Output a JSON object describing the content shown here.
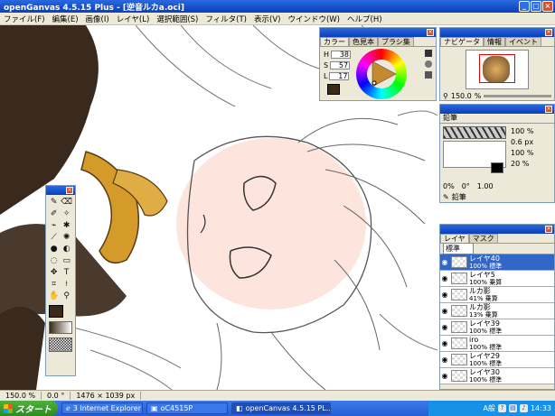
{
  "window": {
    "title": "openGanvas 4.5.15 Plus - [逆音ルカa.oci]",
    "minimize": "_",
    "maximize": "□",
    "close": "×"
  },
  "menu": [
    "ファイル(F)",
    "編集(E)",
    "画像(I)",
    "レイヤ(L)",
    "選択範囲(S)",
    "フィルタ(T)",
    "表示(V)",
    "ウインドウ(W)",
    "ヘルプ(H)"
  ],
  "color_panel": {
    "tabs": [
      "カラー",
      "色見本",
      "ブラシ集"
    ],
    "h_label": "H",
    "h_value": "38",
    "s_label": "S",
    "s_value": "57",
    "l_label": "L",
    "l_value": "17",
    "current_color": "#3a2a16"
  },
  "navigator_panel": {
    "tabs": [
      "ナビゲータ",
      "情報",
      "イベント"
    ],
    "zoom": "150.0",
    "zoom_unit": "%"
  },
  "brush_panel": {
    "title": "鉛筆",
    "opacity": "100",
    "opacity_unit": "%",
    "size": "0.6",
    "size_unit": "px",
    "density": "100",
    "density_unit": "%",
    "min_size": "20",
    "min_size_unit": "%",
    "pressure_1": "0%",
    "pressure_2": "0°",
    "scale": "1.00",
    "tool_name": "鉛筆"
  },
  "layer_panel": {
    "tabs": [
      "レイヤ",
      "マスク"
    ],
    "blend": "標準",
    "layers": [
      {
        "name": "レイヤ40",
        "info": "100% 標準",
        "selected": true
      },
      {
        "name": "レイヤ5",
        "info": "100% 乗算",
        "selected": false
      },
      {
        "name": "ルカ影",
        "info": "41% 乗算",
        "selected": false
      },
      {
        "name": "ルカ影",
        "info": "13% 乗算",
        "selected": false
      },
      {
        "name": "レイヤ39",
        "info": "100% 標準",
        "selected": false
      },
      {
        "name": "iro",
        "info": "100% 標準",
        "selected": false
      },
      {
        "name": "レイヤ29",
        "info": "100% 標準",
        "selected": false
      },
      {
        "name": "レイヤ30",
        "info": "100% 標準",
        "selected": false
      }
    ]
  },
  "status": {
    "zoom": "150.0 %",
    "angle": "0.0 °",
    "size": "1476 × 1039 px"
  },
  "taskbar": {
    "start": "スタート",
    "tasks": [
      "3 Internet Explorer",
      "oC4515P",
      "openCanvas 4.5.15 PL..."
    ],
    "clock": "14:33",
    "ime": "A般"
  },
  "colors": {
    "accent": "#0a3fb8",
    "skin": "#fde5dd",
    "gold": "#d49a2a",
    "dark": "#3a2a1e"
  }
}
